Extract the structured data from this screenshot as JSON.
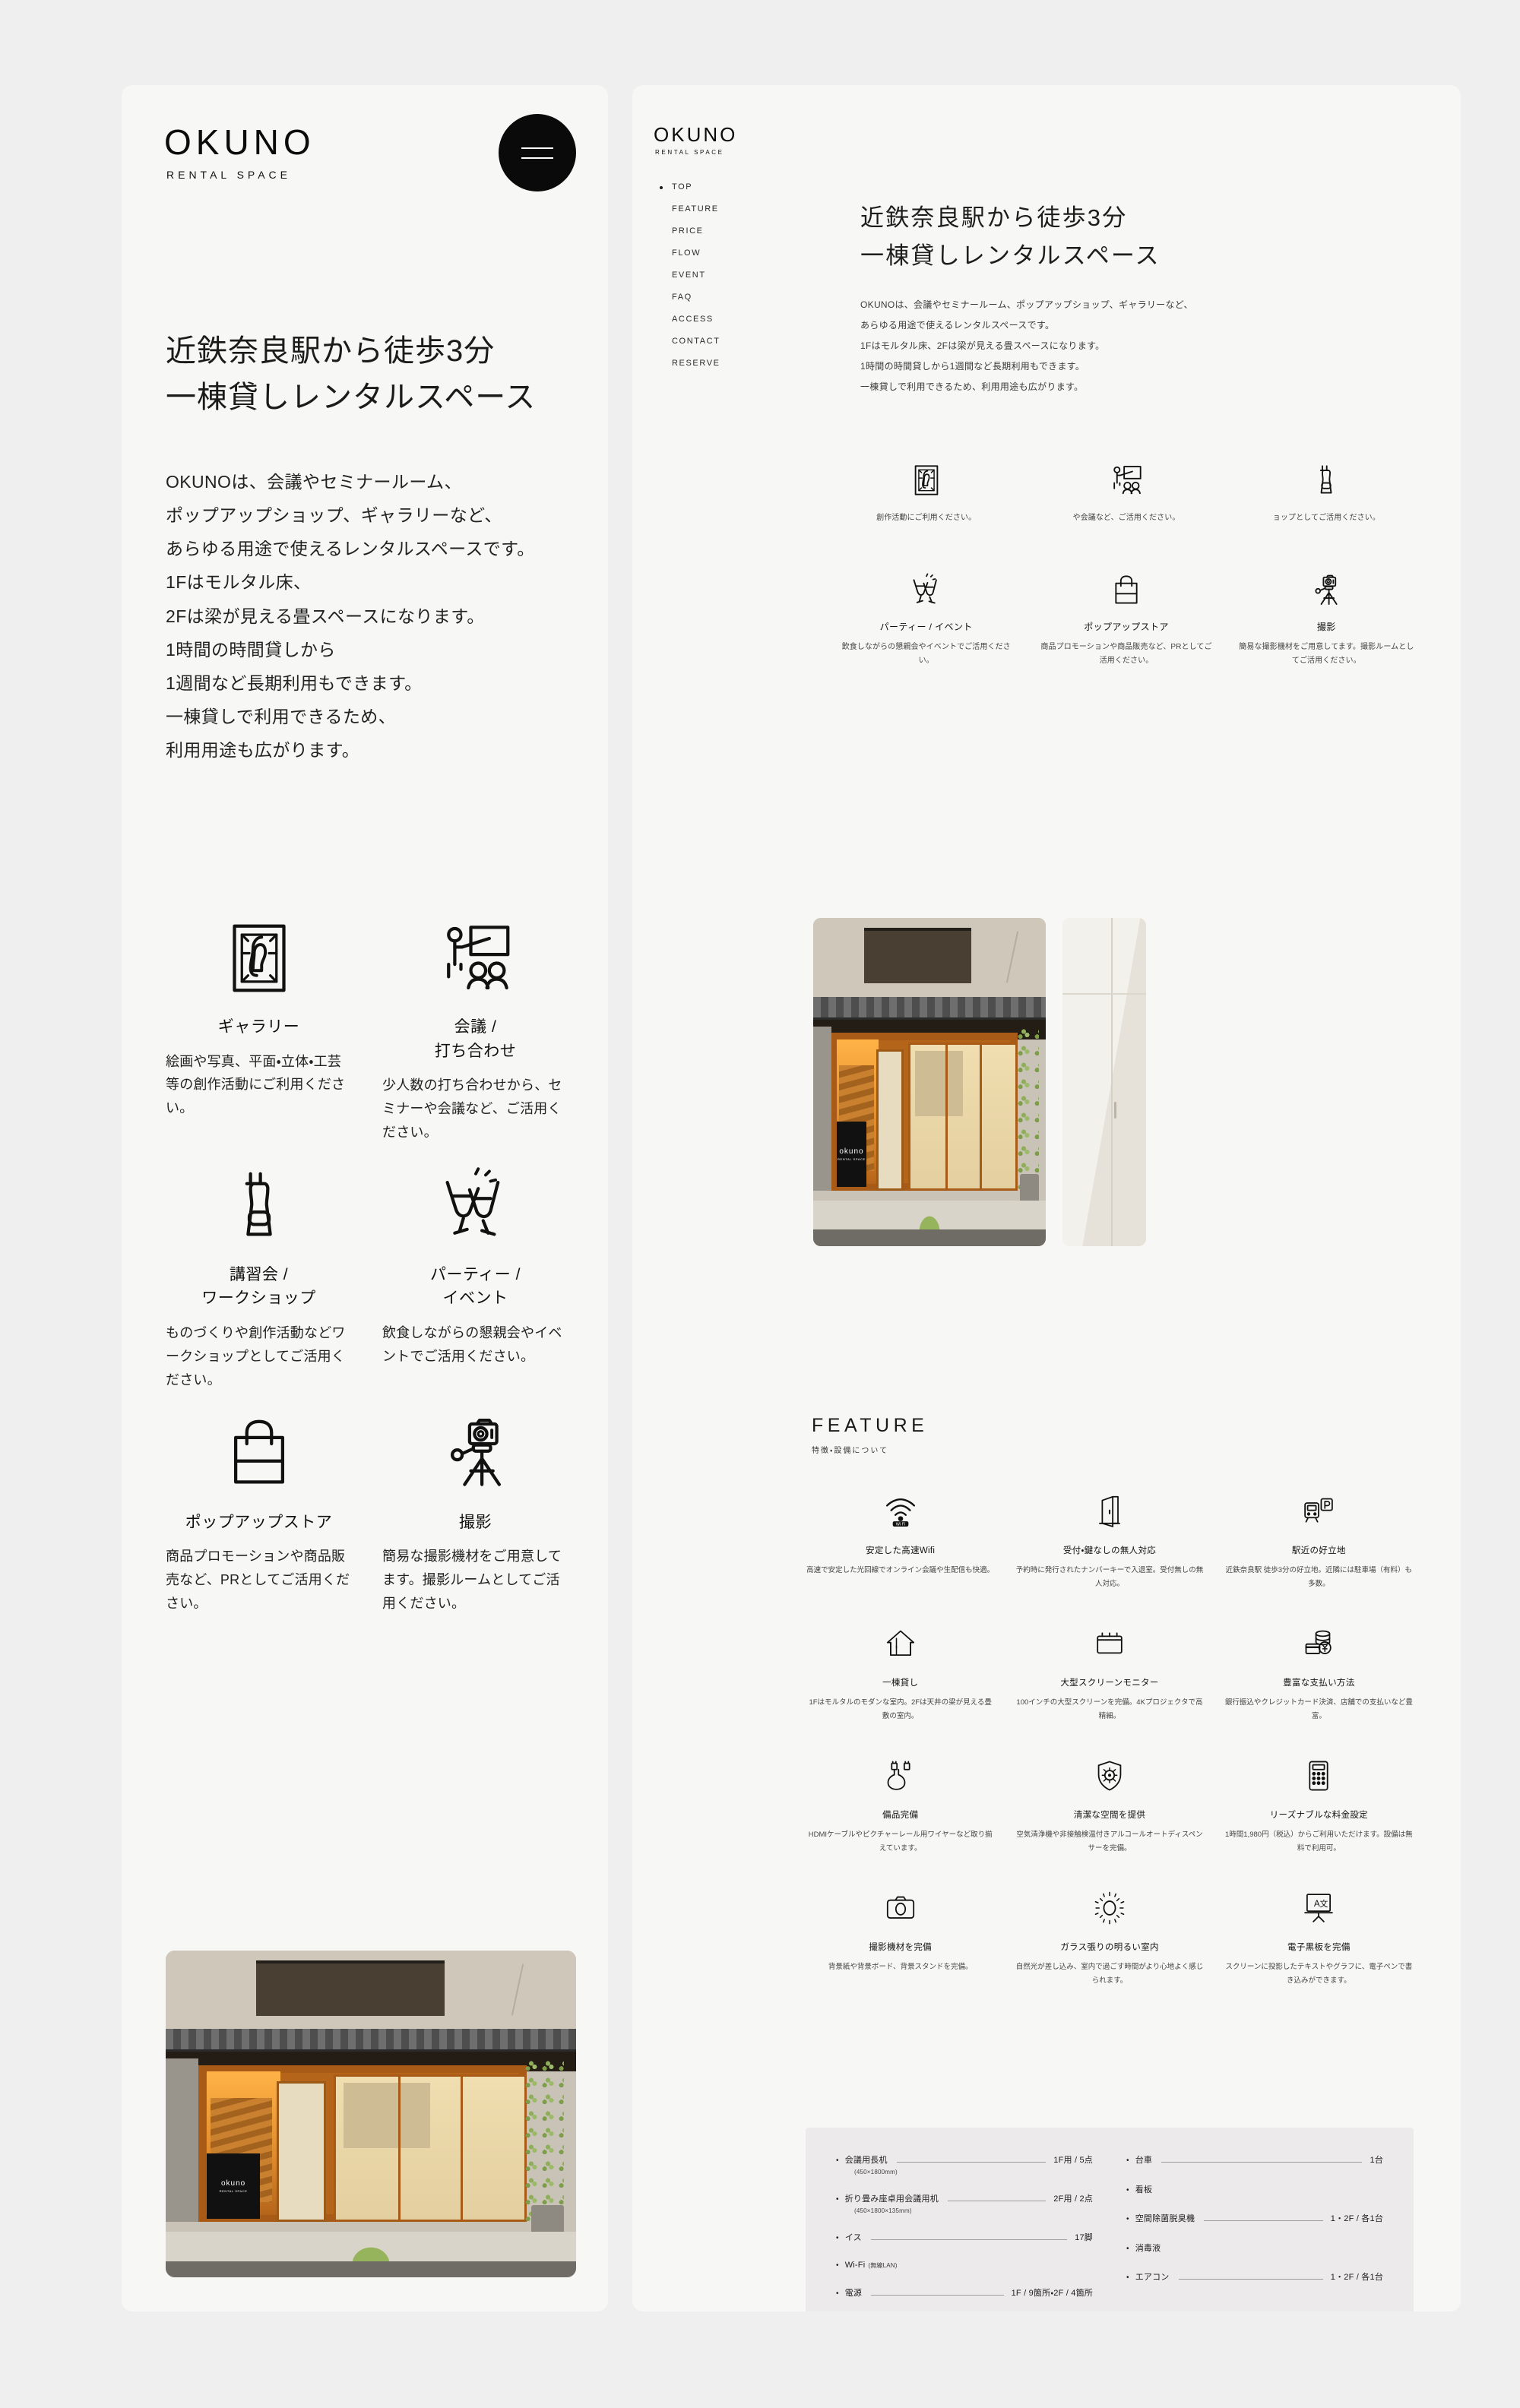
{
  "brand": {
    "name": "OKUNO",
    "tagline": "RENTAL SPACE"
  },
  "left_panel": {
    "menu_button": "menu",
    "hero": {
      "line1": "近鉄奈良駅から徒歩3分",
      "line2": "一棟貸しレンタルスペース"
    },
    "body": [
      "OKUNOは、会議やセミナールーム、",
      "ポップアップショップ、ギャラリーなど、",
      "あらゆる用途で使えるレンタルスペースです。",
      "1Fはモルタル床、",
      "2Fは梁が見える畳スペースになります。",
      "1時間の時間貸しから",
      "1週間など長期利用もできます。",
      "一棟貸しで利用できるため、",
      "利用用途も広がります。"
    ],
    "cards": [
      {
        "icon": "gallery-frame-icon",
        "title": "ギャラリー",
        "desc": "絵画や写真、平面・立体・工芸等の創作活動にご利用ください。"
      },
      {
        "icon": "presentation-icon",
        "title": "会議 /\n打ち合わせ",
        "desc": "少人数の打ち合わせから、セミナーや会議など、ご活用ください。"
      },
      {
        "icon": "apron-icon",
        "title": "講習会 /\nワークショップ",
        "desc": "ものづくりや創作活動などワークショップとしてご活用ください。"
      },
      {
        "icon": "cheers-glasses-icon",
        "title": "パーティー /\nイベント",
        "desc": "飲食しながらの懇親会やイベントでご活用ください。"
      },
      {
        "icon": "shopping-bag-icon",
        "title": "ポップアップストア",
        "desc": "商品プロモーションや商品販売など、PRとしてご活用ください。"
      },
      {
        "icon": "tripod-camera-icon",
        "title": "撮影",
        "desc": "簡易な撮影機材をご用意してます。撮影ルームとしてご活用ください。"
      }
    ],
    "photo_alt": "OKUNO 外観"
  },
  "right_panel": {
    "nav": [
      {
        "label": "TOP",
        "active": true
      },
      {
        "label": "FEATURE",
        "active": false
      },
      {
        "label": "PRICE",
        "active": false
      },
      {
        "label": "FLOW",
        "active": false
      },
      {
        "label": "EVENT",
        "active": false
      },
      {
        "label": "FAQ",
        "active": false
      },
      {
        "label": "ACCESS",
        "active": false
      },
      {
        "label": "CONTACT",
        "active": false
      },
      {
        "label": "RESERVE",
        "active": false
      }
    ],
    "hero": {
      "line1": "近鉄奈良駅から徒歩3分",
      "line2": "一棟貸しレンタルスペース"
    },
    "lead": [
      "OKUNOは、会議やセミナールーム、ポップアップショップ、ギャラリーなど、",
      "あらゆる用途で使えるレンタルスペースです。",
      "1Fはモルタル床、2Fは梁が見える畳スペースになります。",
      "1時間の時間貸しから1週間など長期利用もできます。",
      "一棟貸しで利用できるため、利用用途も広がります。"
    ],
    "use_cards": [
      {
        "icon": "gallery-frame-icon",
        "title": "",
        "desc": "創作活動にご利用ください。",
        "clipped": true
      },
      {
        "icon": "presentation-icon",
        "title": "",
        "desc": "や会議など、ご活用ください。",
        "clipped": true
      },
      {
        "icon": "apron-icon",
        "title": "",
        "desc": "ョップとしてご活用ください。",
        "clipped": true
      },
      {
        "icon": "cheers-glasses-icon",
        "title": "パーティー / イベント",
        "desc": "飲食しながらの懇親会やイベントでご活用ください。",
        "clipped": false
      },
      {
        "icon": "shopping-bag-icon",
        "title": "ポップアップストア",
        "desc": "商品プロモーションや商品販売など、PRとしてご活用ください。",
        "clipped": false
      },
      {
        "icon": "tripod-camera-icon",
        "title": "撮影",
        "desc": "簡易な撮影機材をご用意してます。撮影ルームとしてご活用ください。",
        "clipped": false
      }
    ],
    "feature": {
      "heading_en": "FEATURE",
      "heading_ja": "特徴・設備について",
      "items": [
        {
          "icon": "wifi-icon",
          "title": "安定した高速Wifi",
          "desc": "高速で安定した光回線でオンライン会議や生配信も快適。"
        },
        {
          "icon": "open-door-icon",
          "title": "受付・鍵なしの無人対応",
          "desc": "予約時に発行されたナンバーキーで入退室。受付無しの無人対応。"
        },
        {
          "icon": "train-parking-icon",
          "title": "駅近の好立地",
          "desc": "近鉄奈良駅 徒歩3分の好立地。近隣には駐車場（有料）も多数。"
        },
        {
          "icon": "house-icon",
          "title": "一棟貸し",
          "desc": "1Fはモルタルのモダンな室内。2Fは天井の梁が見える畳敷の室内。"
        },
        {
          "icon": "screen-monitor-icon",
          "title": "大型スクリーンモニター",
          "desc": "100インチの大型スクリーンを完備。4Kプロジェクタで高精細。"
        },
        {
          "icon": "payment-icon",
          "title": "豊富な支払い方法",
          "desc": "銀行振込やクレジットカード決済、店舗での支払いなど豊富。"
        },
        {
          "icon": "hdmi-cable-icon",
          "title": "備品完備",
          "desc": "HDMIケーブルやピクチャーレール用ワイヤーなど取り揃えています。"
        },
        {
          "icon": "shield-virus-icon",
          "title": "清潔な空間を提供",
          "desc": "空気清浄機や非接触検温付きアルコールオートディスペンサーを完備。"
        },
        {
          "icon": "calculator-icon",
          "title": "リーズナブルな料金設定",
          "desc": "1時間1,980円（税込）からご利用いただけます。設備は無料で利用可。"
        },
        {
          "icon": "camera-icon",
          "title": "撮影機材を完備",
          "desc": "背景紙や背景ボード、背景スタンドを完備。"
        },
        {
          "icon": "sun-icon",
          "title": "ガラス張りの明るい室内",
          "desc": "自然光が差し込み、室内で過ごす時間がより心地よく感じられます。"
        },
        {
          "icon": "whiteboard-text-icon",
          "title": "電子黒板を完備",
          "desc": "スクリーンに投影したテキストやグラフに、電子ペンで書き込みができます。"
        }
      ]
    },
    "equipment": {
      "left": [
        {
          "name": "会議用長机",
          "dim": "(450×1800mm)",
          "qty": "1F用 / 5点",
          "lead": true
        },
        {
          "name": "折り畳み座卓用会議用机",
          "dim": "(450×1800×135mm)",
          "qty": "2F用 / 2点",
          "lead": true
        },
        {
          "name": "イス",
          "dim": "",
          "qty": "17脚",
          "lead": true
        },
        {
          "name": "Wi-Fi",
          "sub": "(無線LAN)",
          "dim": "",
          "qty": "",
          "lead": false
        },
        {
          "name": "電源",
          "dim": "",
          "qty": "1F / 9箇所・2F / 4箇所",
          "lead": true
        }
      ],
      "right": [
        {
          "name": "台車",
          "dim": "",
          "qty": "1台",
          "lead": true
        },
        {
          "name": "看板",
          "dim": "",
          "qty": "",
          "lead": false
        },
        {
          "name": "空間除菌脱臭機",
          "dim": "",
          "qty": "1・2F / 各1台",
          "lead": true
        },
        {
          "name": "消毒液",
          "dim": "",
          "qty": "",
          "lead": false
        },
        {
          "name": "エアコン",
          "dim": "",
          "qty": "1・2F / 各1台",
          "lead": true
        }
      ]
    },
    "photo_alt": "OKUNO 外観",
    "photo_next_alt": "室内"
  },
  "colors": {
    "page_bg": "#efefef",
    "panel_bg": "#f7f7f5",
    "ink": "#111111",
    "accent": "#0a0a0a",
    "eq_bg": "#eceaea"
  }
}
